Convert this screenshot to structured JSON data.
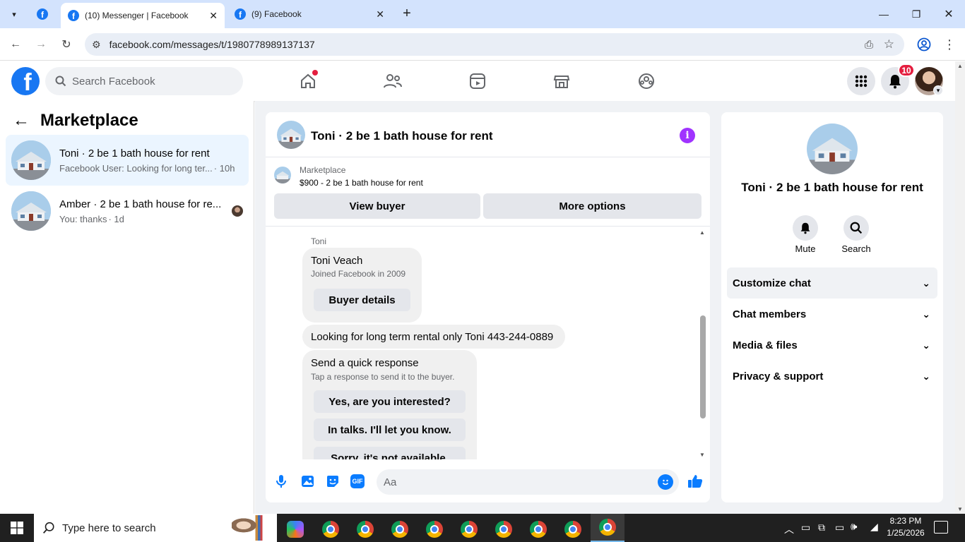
{
  "browser": {
    "tabs": [
      {
        "title": "(10) Messenger | Facebook",
        "active": true
      },
      {
        "title": "(9) Facebook",
        "active": false
      }
    ],
    "url": "facebook.com/messages/t/1980778989137137"
  },
  "fb": {
    "search_placeholder": "Search Facebook",
    "notification_count": "10",
    "brand_color": "#1877f2"
  },
  "sidebar": {
    "title": "Marketplace",
    "conversations": [
      {
        "name": "Toni · 2 be 1 bath house for rent",
        "preview": "Facebook User: Looking for long ter...",
        "time": "· 10h",
        "active": true
      },
      {
        "name": "Amber · 2 be 1 bath house for re...",
        "preview": "You: thanks",
        "time": "· 1d",
        "active": false
      }
    ]
  },
  "chat": {
    "title": "Toni · 2 be 1 bath house for rent",
    "listing_source": "Marketplace",
    "listing_title": "$900 - 2 be 1 bath house for rent",
    "view_buyer_label": "View buyer",
    "more_options_label": "More options",
    "sender_label": "Toni",
    "profile_card": {
      "name": "Toni Veach",
      "joined": "Joined Facebook in 2009",
      "button": "Buyer details"
    },
    "message": "Looking for long term rental only Toni 443-244-0889",
    "quick_response": {
      "title": "Send a quick response",
      "subtitle": "Tap a response to send it to the buyer.",
      "options": [
        "Yes, are you interested?",
        "In talks. I'll let you know.",
        "Sorry, it's not available."
      ]
    },
    "composer_placeholder": "Aa"
  },
  "details": {
    "title": "Toni · 2 be 1 bath house for rent",
    "mute_label": "Mute",
    "search_label": "Search",
    "sections": [
      "Customize chat",
      "Chat members",
      "Media & files",
      "Privacy & support"
    ]
  },
  "taskbar": {
    "search_placeholder": "Type here to search",
    "time": "8:23 PM",
    "date": "1/25/2026"
  }
}
